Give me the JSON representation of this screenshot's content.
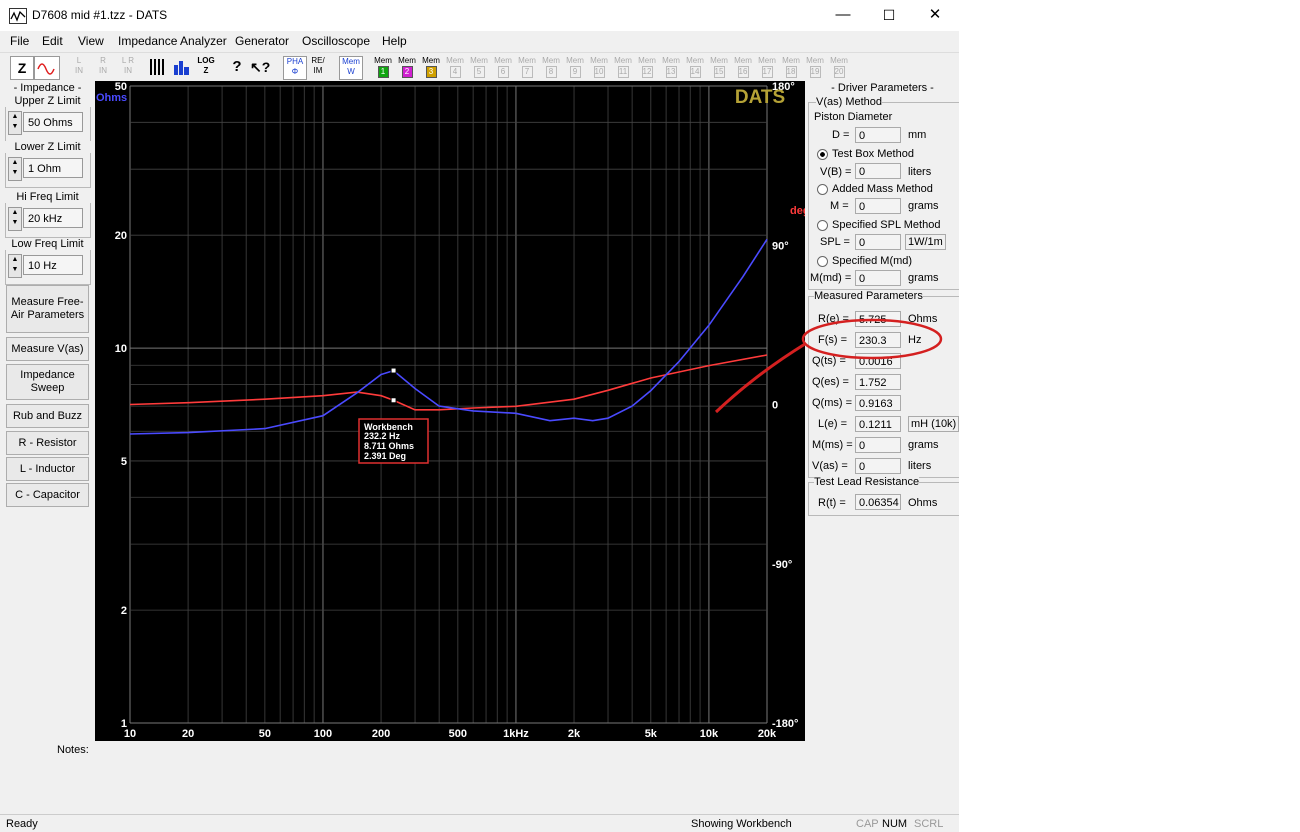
{
  "window": {
    "title": "D7608 mid #1.tzz - DATS",
    "minimize": "—",
    "maximize": "☐",
    "close": "✕"
  },
  "menu": [
    "File",
    "Edit",
    "View",
    "Impedance Analyzer",
    "Generator",
    "Oscilloscope",
    "Help"
  ],
  "toolbar": {
    "z": "Z",
    "lin_items": [
      "L\nIN",
      "R\nIN",
      "L R\nIN"
    ],
    "pha": "PHA\nΦ",
    "re_im": "RE/\nIM",
    "mem_w": "Mem\nW",
    "mems": [
      "1",
      "2",
      "3",
      "4",
      "5",
      "6",
      "7",
      "8",
      "9",
      "10",
      "11",
      "12",
      "13",
      "14",
      "15",
      "16",
      "17",
      "18",
      "19",
      "20"
    ],
    "mem_label": "Mem"
  },
  "left": {
    "impedance_title": "- Impedance -",
    "upper_label": "Upper Z Limit",
    "upper_value": "50 Ohms",
    "lower_label": "Lower Z Limit",
    "lower_value": "1 Ohm",
    "hi_label": "Hi Freq Limit",
    "hi_value": "20 kHz",
    "low_label": "Low Freq Limit",
    "low_value": "10 Hz",
    "buttons": [
      "Measure Free-Air Parameters",
      "Measure V(as)",
      "Impedance Sweep",
      "Rub and Buzz",
      "R - Resistor",
      "L - Inductor",
      "C - Capacitor"
    ]
  },
  "graph": {
    "brand": "DATS",
    "left_unit": "Ohms",
    "right_unit": "deg",
    "yticks": [
      "50",
      "20",
      "10",
      "5",
      "2",
      "1"
    ],
    "phase_ticks": [
      "180°",
      "90°",
      "0",
      "-90°",
      "-180°"
    ],
    "xticks": [
      "10",
      "20",
      "50",
      "100",
      "200",
      "500",
      "1kHz",
      "2k",
      "5k",
      "10k",
      "20k"
    ],
    "workbench": {
      "title": "Workbench",
      "freq": "232.2 Hz",
      "z": "8.711 Ohms",
      "phase": "2.391 Deg"
    }
  },
  "chart_data": {
    "type": "line",
    "xscale": "log",
    "yscale": "log",
    "xlim": [
      10,
      20000
    ],
    "ylim": [
      1,
      50
    ],
    "y2lim": [
      -180,
      180
    ],
    "series": [
      {
        "name": "Ohms",
        "color": "#4a4aff",
        "x": [
          10,
          20,
          50,
          100,
          150,
          200,
          232,
          300,
          400,
          600,
          1000,
          1500,
          2000,
          2500,
          3000,
          4000,
          5000,
          7000,
          10000,
          15000,
          20000
        ],
        "y": [
          5.9,
          5.95,
          6.1,
          6.6,
          7.6,
          8.5,
          8.71,
          7.8,
          7.0,
          6.8,
          6.7,
          6.4,
          6.5,
          6.4,
          6.5,
          7.0,
          7.7,
          9.2,
          11.5,
          15.5,
          19.5
        ]
      },
      {
        "name": "deg",
        "color": "#ff3b3b",
        "x": [
          10,
          20,
          50,
          100,
          150,
          200,
          232,
          300,
          400,
          600,
          1000,
          2000,
          3000,
          5000,
          10000,
          20000
        ],
        "y": [
          0,
          1,
          3,
          5,
          7,
          5,
          2.4,
          -3,
          -3,
          -2,
          -1,
          3,
          8,
          15,
          22,
          28
        ]
      }
    ],
    "marker": {
      "x": 232.2,
      "y": 8.711,
      "phase": 2.391
    }
  },
  "right": {
    "title": "- Driver Parameters -",
    "vas_method": "V(as) Method",
    "piston": "Piston Diameter",
    "d_label": "D =",
    "d_value": "0",
    "d_unit": "mm",
    "testbox": "Test Box Method",
    "vb_label": "V(B) =",
    "vb_value": "0",
    "vb_unit": "liters",
    "addedmass": "Added Mass Method",
    "m_label": "M =",
    "m_value": "0",
    "m_unit": "grams",
    "spl_method": "Specified SPL Method",
    "spl_label": "SPL =",
    "spl_value": "0",
    "spl_unit": "1W/1m",
    "md_method": "Specified M(md)",
    "md_label": "M(md) =",
    "md_value": "0",
    "md_unit": "grams",
    "measured": "Measured Parameters",
    "params": [
      {
        "label": "R(e) =",
        "value": "5.725",
        "unit": "Ohms"
      },
      {
        "label": "F(s) =",
        "value": "230.3",
        "unit": "Hz"
      },
      {
        "label": "Q(ts) =",
        "value": "0.0016",
        "unit": ""
      },
      {
        "label": "Q(es) =",
        "value": "1.752",
        "unit": ""
      },
      {
        "label": "Q(ms) =",
        "value": "0.9163",
        "unit": ""
      },
      {
        "label": "L(e) =",
        "value": "0.1211",
        "unit": "mH (10k)"
      },
      {
        "label": "M(ms) =",
        "value": "0",
        "unit": "grams"
      },
      {
        "label": "V(as) =",
        "value": "0",
        "unit": "liters"
      }
    ],
    "lead_title": "Test Lead Resistance",
    "rt_label": "R(t) =",
    "rt_value": "0.06354",
    "rt_unit": "Ohms"
  },
  "notes_label": "Notes:",
  "status": {
    "ready": "Ready",
    "showing": "Showing Workbench",
    "cap": "CAP",
    "num": "NUM",
    "scrl": "SCRL"
  }
}
